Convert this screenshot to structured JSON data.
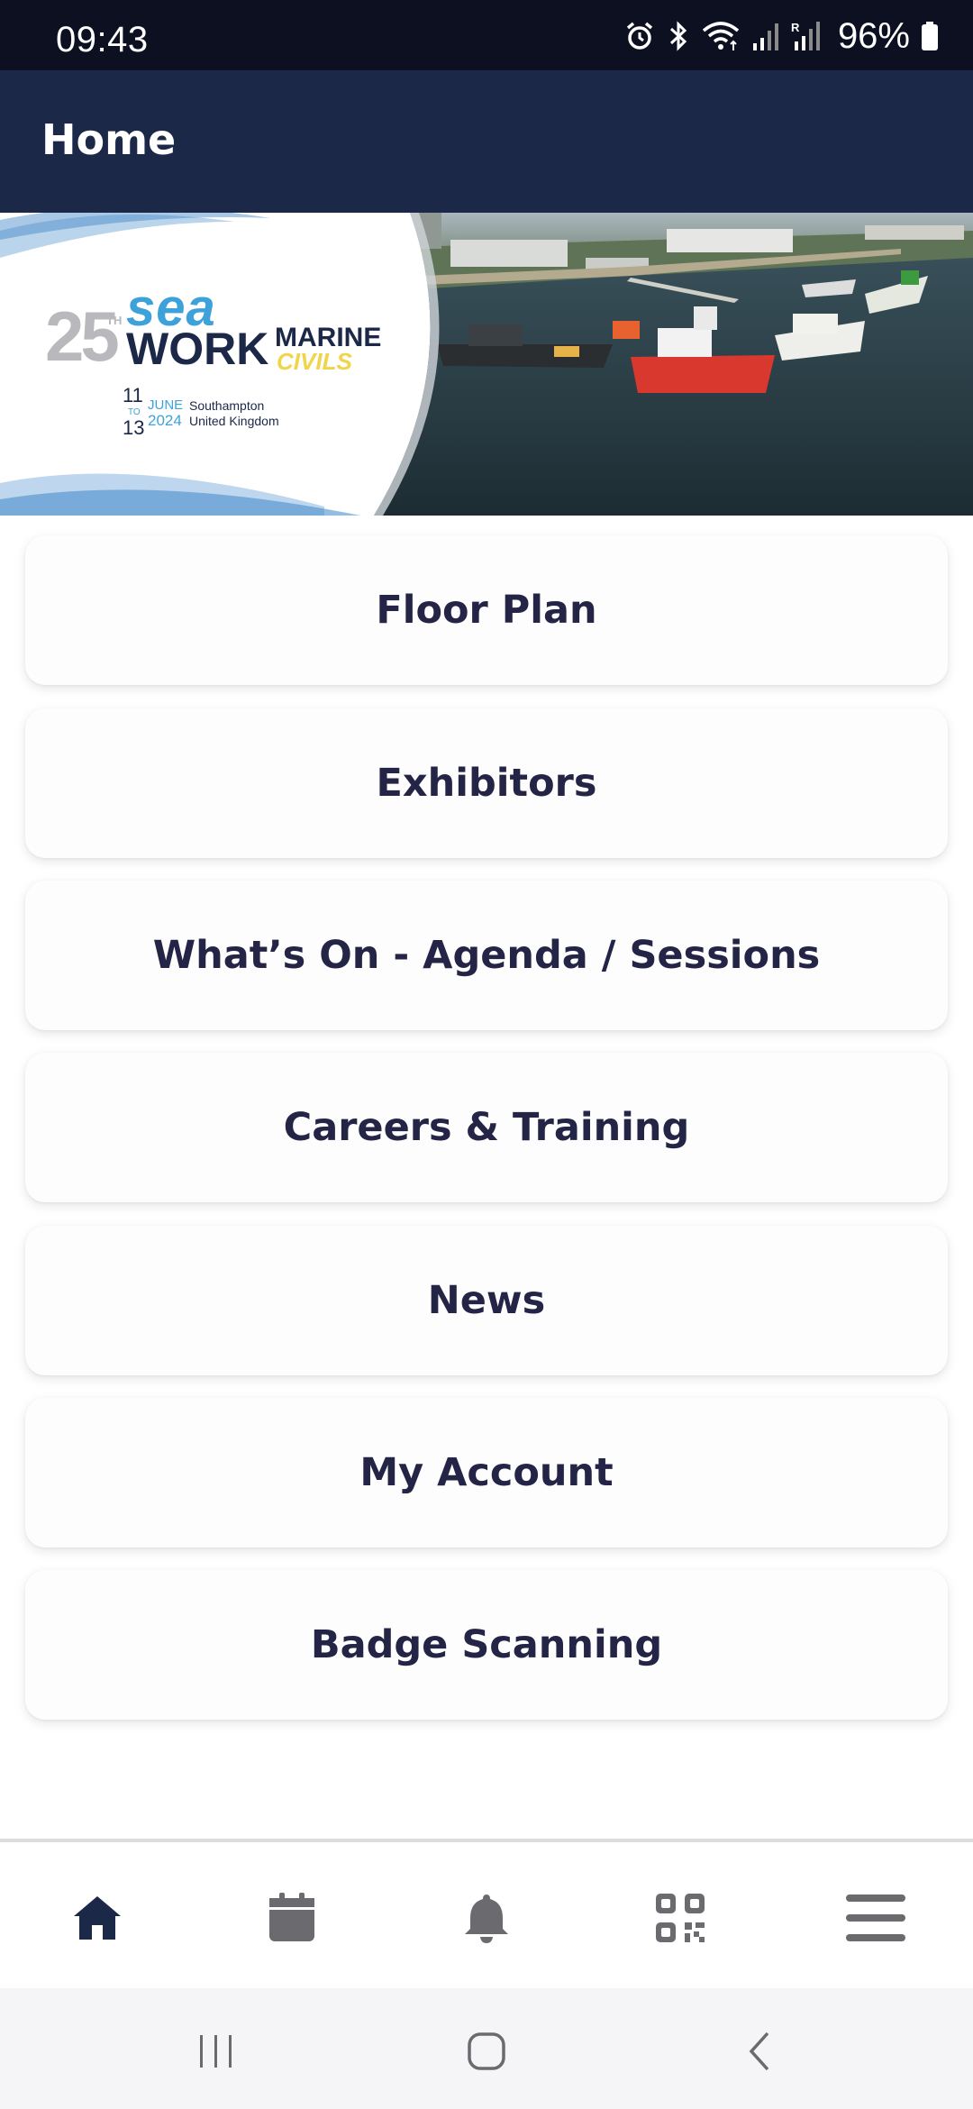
{
  "status_bar": {
    "time": "09:43",
    "battery_percent": "96%",
    "icons": [
      "alarm-icon",
      "bluetooth-icon",
      "wifi-icon",
      "signal-icon",
      "signal-roaming-icon",
      "battery-icon"
    ],
    "roaming_indicator": "R"
  },
  "app_bar": {
    "title": "Home"
  },
  "banner": {
    "logo": {
      "edition": "25",
      "edition_suffix": "TH",
      "word1": "sea",
      "word2": "WORK",
      "word3": "MARINE",
      "word4": "CIVILS"
    },
    "dates": {
      "start_day": "11",
      "to": "TO",
      "end_day": "13",
      "month": "JUNE",
      "year": "2024"
    },
    "location": {
      "city": "Southampton",
      "country": "United Kingdom"
    }
  },
  "menu": {
    "items": [
      {
        "label": "Floor Plan"
      },
      {
        "label": "Exhibitors"
      },
      {
        "label": "What’s On - Agenda / Sessions"
      },
      {
        "label": "Careers & Training"
      },
      {
        "label": "News"
      },
      {
        "label": "My Account"
      },
      {
        "label": "Badge Scanning"
      }
    ]
  },
  "bottom_nav": {
    "items": [
      "home-icon",
      "calendar-icon",
      "bell-icon",
      "qr-code-icon",
      "menu-icon"
    ],
    "active": "home-icon"
  },
  "system_nav": {
    "buttons": [
      "recents-icon",
      "home-icon",
      "back-icon"
    ]
  },
  "colors": {
    "status_bar_bg": "#0d1020",
    "app_bar_bg": "#1c2848",
    "menu_text": "#242446",
    "nav_active": "#1c2848",
    "nav_inactive": "#6b6b6f",
    "brand_blue": "#3ea2da",
    "brand_yellow": "#f0d54a"
  }
}
